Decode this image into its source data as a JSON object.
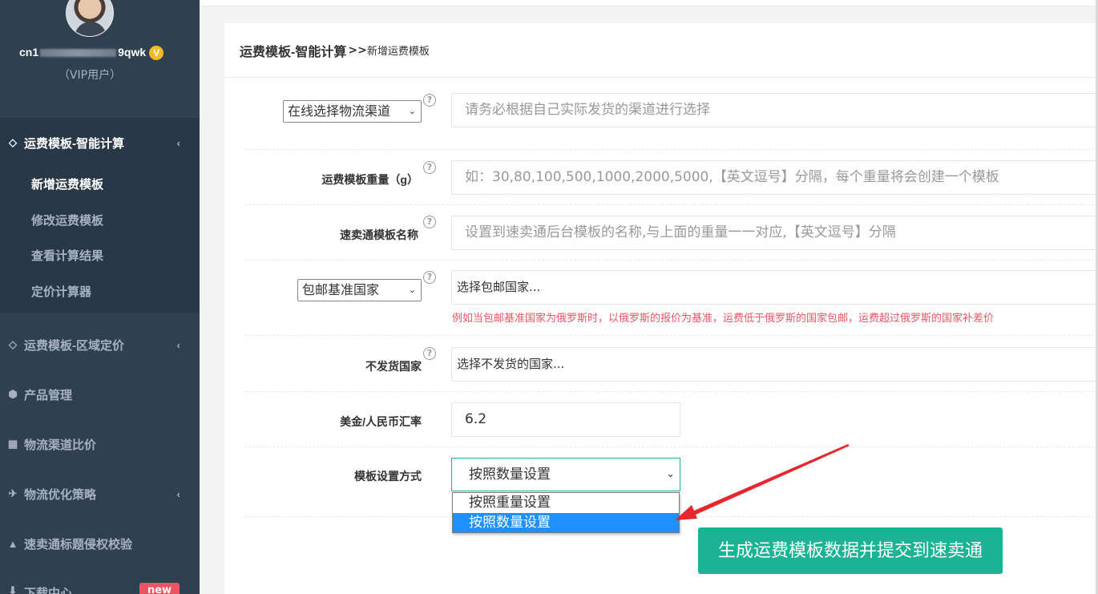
{
  "sidebar": {
    "profile": {
      "username_start": "cn1",
      "username_end": "9qwk",
      "badge": "V",
      "role": "（VIP用户）"
    },
    "groups": [
      {
        "label": "运费模板-智能计算",
        "icon": "diamond-icon",
        "items": [
          "新增运费模板",
          "修改运费模板",
          "查看计算结果",
          "定价计算器"
        ],
        "active_item": "新增运费模板"
      },
      {
        "label": "运费模板-区域定价",
        "icon": "diamond-icon"
      },
      {
        "label": "产品管理",
        "icon": "cube-icon"
      },
      {
        "label": "物流渠道比价",
        "icon": "calculator-icon"
      },
      {
        "label": "物流优化策略",
        "icon": "plane-icon"
      },
      {
        "label": "速卖通标题侵权校验",
        "icon": "warning-icon"
      },
      {
        "label": "下载中心",
        "icon": "download-icon",
        "badge": "new"
      }
    ]
  },
  "header": {
    "title": "运费模板-智能计算",
    "separator": ">>",
    "subtitle": "新增运费模板"
  },
  "form": {
    "channel": {
      "select_value": "在线选择物流渠道",
      "placeholder": "请务必根据自己实际发货的渠道进行选择"
    },
    "weight": {
      "label": "运费模板重量（g）",
      "placeholder": "如：30,80,100,500,1000,2000,5000,【英文逗号】分隔，每个重量将会创建一个模板"
    },
    "template_name": {
      "label": "速卖通模板名称",
      "placeholder": "设置到速卖通后台模板的名称,与上面的重量一一对应,【英文逗号】分隔"
    },
    "base_country": {
      "select_value": "包邮基准国家",
      "placeholder": "选择包邮国家...",
      "hint": "例如当包邮基准国家为俄罗斯时，以俄罗斯的报价为基准，运费低于俄罗斯的国家包邮，运费超过俄罗斯的国家补差价"
    },
    "no_ship": {
      "label": "不发货国家",
      "placeholder": "选择不发货的国家..."
    },
    "rate": {
      "label": "美金/人民币汇率",
      "value": "6.2"
    },
    "mode": {
      "label": "模板设置方式",
      "value": "按照数量设置",
      "options": [
        "按照重量设置",
        "按照数量设置"
      ],
      "selected_index": 1
    },
    "help_glyph": "?",
    "submit_label": "生成运费模板数据并提交到速卖通"
  },
  "colors": {
    "sidebar_bg": "#2f4050",
    "accent": "#1ab394",
    "hint_red": "#ed5565",
    "annotation_arrow": "#e8262d",
    "option_highlight": "#1e90ff"
  }
}
